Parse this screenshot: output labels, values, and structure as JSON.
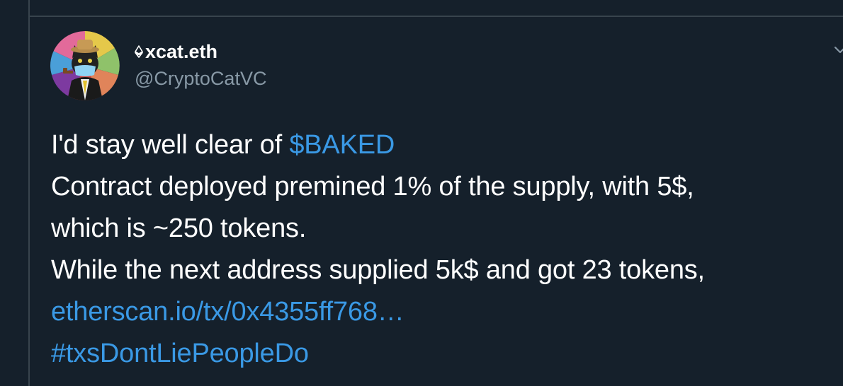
{
  "user": {
    "eth_glyph": "⟠",
    "display_name": "xcat.eth",
    "handle": "@CryptoCatVC"
  },
  "tweet": {
    "line1_text": "I'd stay well clear of ",
    "cashtag": "$BAKED",
    "line2": "Contract deployed premined 1% of the supply, with 5$,",
    "line3": "which is ~250 tokens.",
    "line4": "While the next address supplied 5k$ and got 23 tokens,",
    "link": "etherscan.io/tx/0x4355ff768…",
    "hashtag": "#txsDontLiePeopleDo"
  },
  "colors": {
    "background": "#15202b",
    "border": "#38444d",
    "text": "#ffffff",
    "secondary": "#8899a6",
    "link": "#3a99e5"
  },
  "icons": {
    "avatar": "cat-avatar-icon",
    "caret": "chevron-down-icon",
    "eth": "ethereum-icon"
  }
}
